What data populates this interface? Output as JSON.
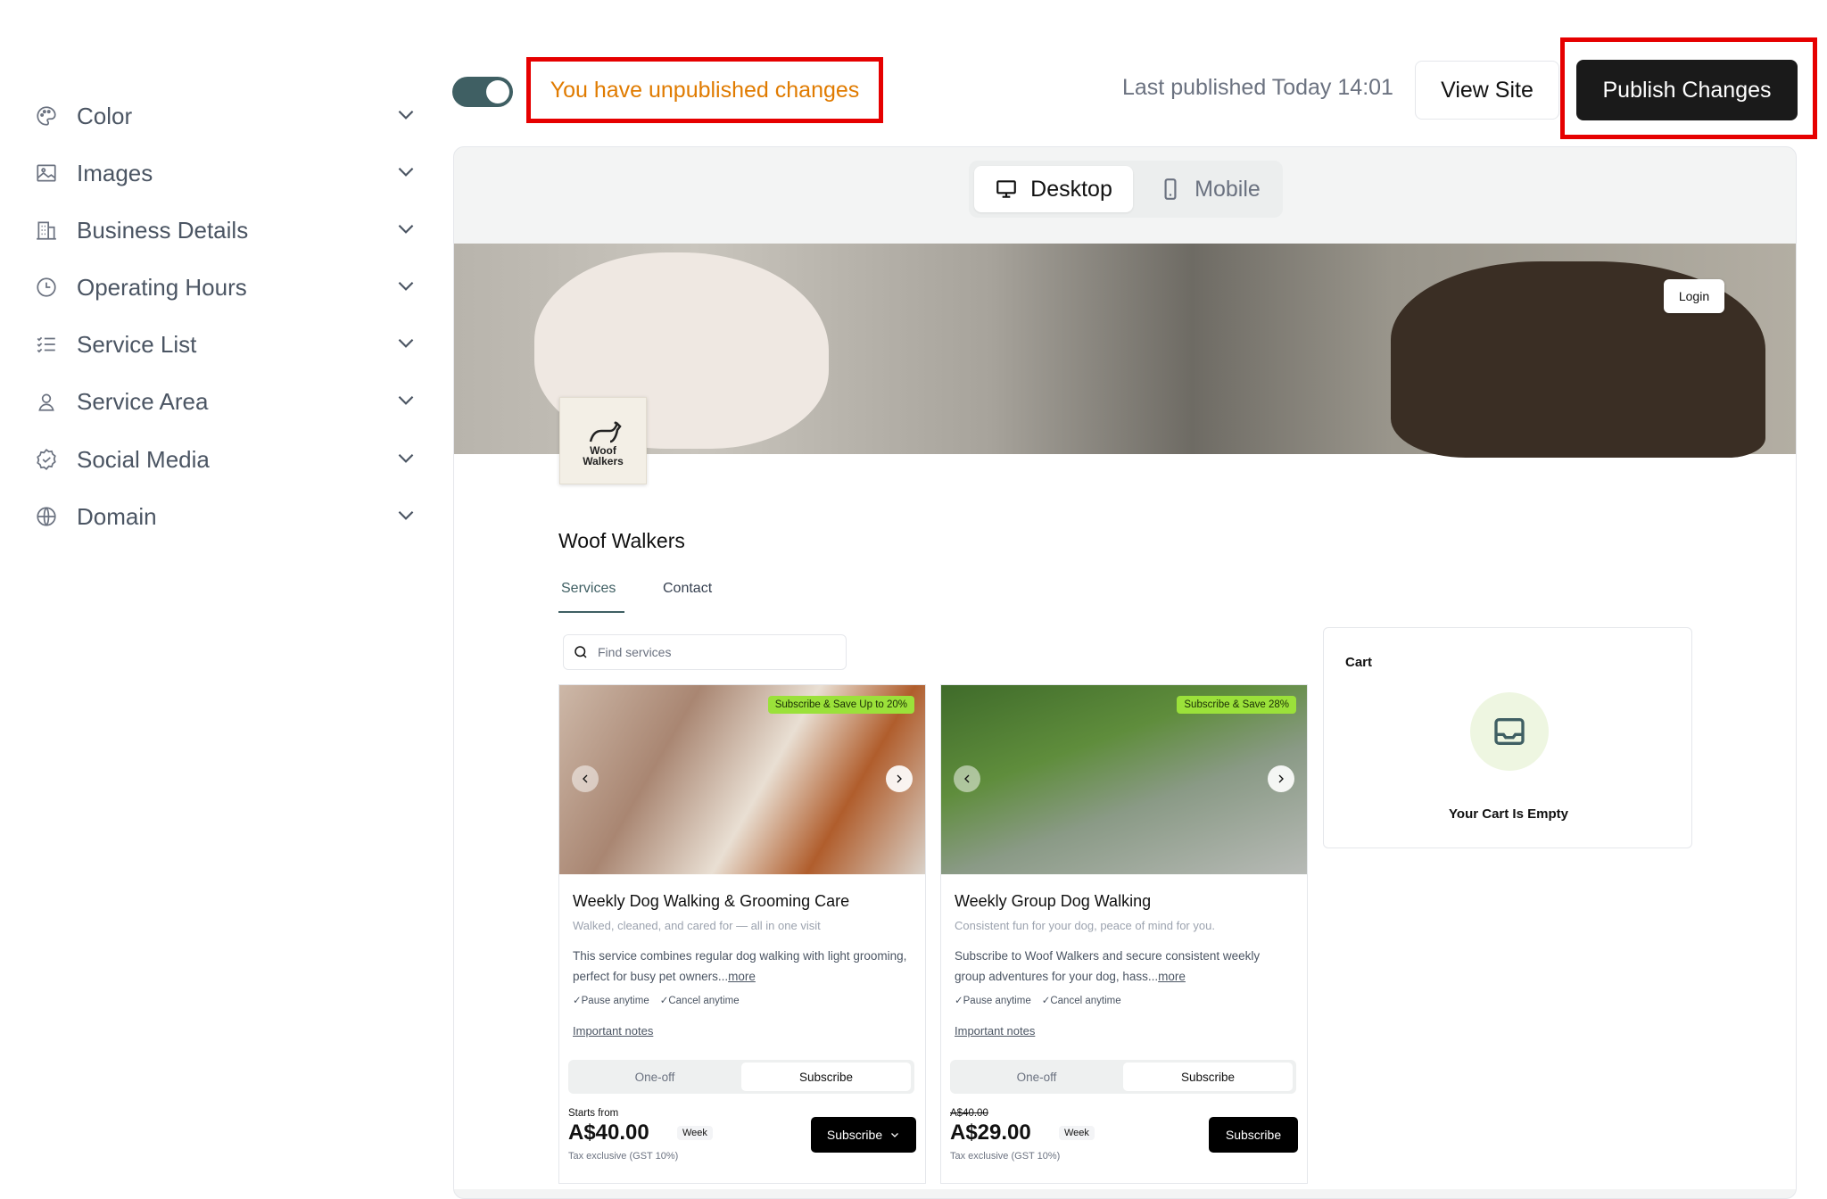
{
  "sidebar": {
    "items": [
      {
        "label": "Color",
        "icon": "palette-icon"
      },
      {
        "label": "Images",
        "icon": "image-icon"
      },
      {
        "label": "Business Details",
        "icon": "building-icon"
      },
      {
        "label": "Operating Hours",
        "icon": "clock-icon"
      },
      {
        "label": "Service List",
        "icon": "list-check-icon"
      },
      {
        "label": "Service Area",
        "icon": "map-pin-icon"
      },
      {
        "label": "Social Media",
        "icon": "badge-check-icon"
      },
      {
        "label": "Domain",
        "icon": "globe-icon"
      }
    ]
  },
  "topbar": {
    "unpublished_text": "You have unpublished changes",
    "last_published": "Last published Today 14:01",
    "view_site": "View Site",
    "publish": "Publish Changes",
    "toggle_on": true
  },
  "preview": {
    "desktop": "Desktop",
    "mobile": "Mobile",
    "login": "Login",
    "logo_text_1": "Woof",
    "logo_text_2": "Walkers",
    "business_name": "Woof Walkers",
    "tabs": [
      "Services",
      "Contact"
    ],
    "search_placeholder": "Find services",
    "services": [
      {
        "promo": "Subscribe & Save Up to 20%",
        "title": "Weekly Dog Walking & Grooming Care",
        "subtitle": "Walked, cleaned, and cared for — all in one visit",
        "desc": "This service combines regular dog walking with light grooming, perfect for busy pet owners...",
        "more": "more",
        "check1": "Pause anytime",
        "check2": "Cancel anytime",
        "notes": "Important notes",
        "seg_one": "One-off",
        "seg_sub": "Subscribe",
        "price_top": "Starts from",
        "price": "A$40.00",
        "per": "Week",
        "tax": "Tax exclusive (GST 10%)",
        "button": "Subscribe"
      },
      {
        "promo": "Subscribe & Save 28%",
        "title": "Weekly Group Dog Walking",
        "subtitle": "Consistent fun for your dog, peace of mind for you.",
        "desc": "Subscribe to Woof Walkers and secure consistent weekly group adventures for your dog, hass...",
        "more": "more",
        "check1": "Pause anytime",
        "check2": "Cancel anytime",
        "notes": "Important notes",
        "seg_one": "One-off",
        "seg_sub": "Subscribe",
        "price_top": "A$40.00",
        "price": "A$29.00",
        "per": "Week",
        "tax": "Tax exclusive (GST 10%)",
        "button": "Subscribe"
      }
    ],
    "cart_title": "Cart",
    "cart_empty": "Your Cart Is Empty"
  },
  "colors": {
    "accent": "#3f5f63",
    "warning": "#e07b00",
    "highlight": "#e60000",
    "promo": "#9be13a"
  }
}
